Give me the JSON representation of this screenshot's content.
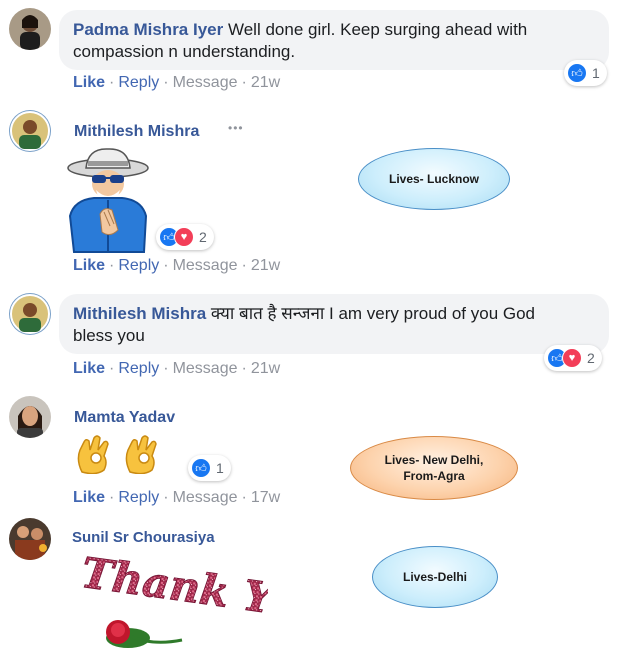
{
  "comments": [
    {
      "author": "Padma Mishra Iyer",
      "text_line1": "Well done girl. Keep surging ahead with",
      "text_line2": "compassion n understanding.",
      "actions": {
        "like": "Like",
        "reply": "Reply",
        "message": "Message",
        "time": "21w"
      },
      "reaction_count": "1"
    },
    {
      "author": "Mithilesh Mishra",
      "more": "•••",
      "actions": {
        "like": "Like",
        "reply": "Reply",
        "message": "Message",
        "time": "21w"
      },
      "reaction_count": "2"
    },
    {
      "author": "Mithilesh Mishra",
      "text_line1": "क्या बात है सन्जना I am very proud of you God",
      "text_line2": "bless you",
      "actions": {
        "like": "Like",
        "reply": "Reply",
        "message": "Message",
        "time": "21w"
      },
      "reaction_count": "2"
    },
    {
      "author": "Mamta Yadav",
      "actions": {
        "like": "Like",
        "reply": "Reply",
        "message": "Message",
        "time": "17w"
      },
      "reaction_count": "1"
    },
    {
      "author": "Sunil Sr Chourasiya",
      "sticker_text": "Thank You"
    }
  ],
  "annotations": {
    "lucknow": "Lives- Lucknow",
    "delhi_line1": "Lives- New Delhi,",
    "delhi_line2": "From-Agra",
    "delhi2": "Lives-Delhi"
  },
  "separator": "·",
  "colors": {
    "name_blue": "#385898",
    "link_blue": "#4267b2",
    "meta_gray": "#90949c",
    "bubble_bg": "#f2f3f5",
    "like_blue": "#1877f2",
    "love_red": "#f33e58"
  },
  "icons": [
    "like-icon",
    "love-icon",
    "ok-hand-emoji",
    "sticker-man",
    "thank-you-sticker"
  ]
}
